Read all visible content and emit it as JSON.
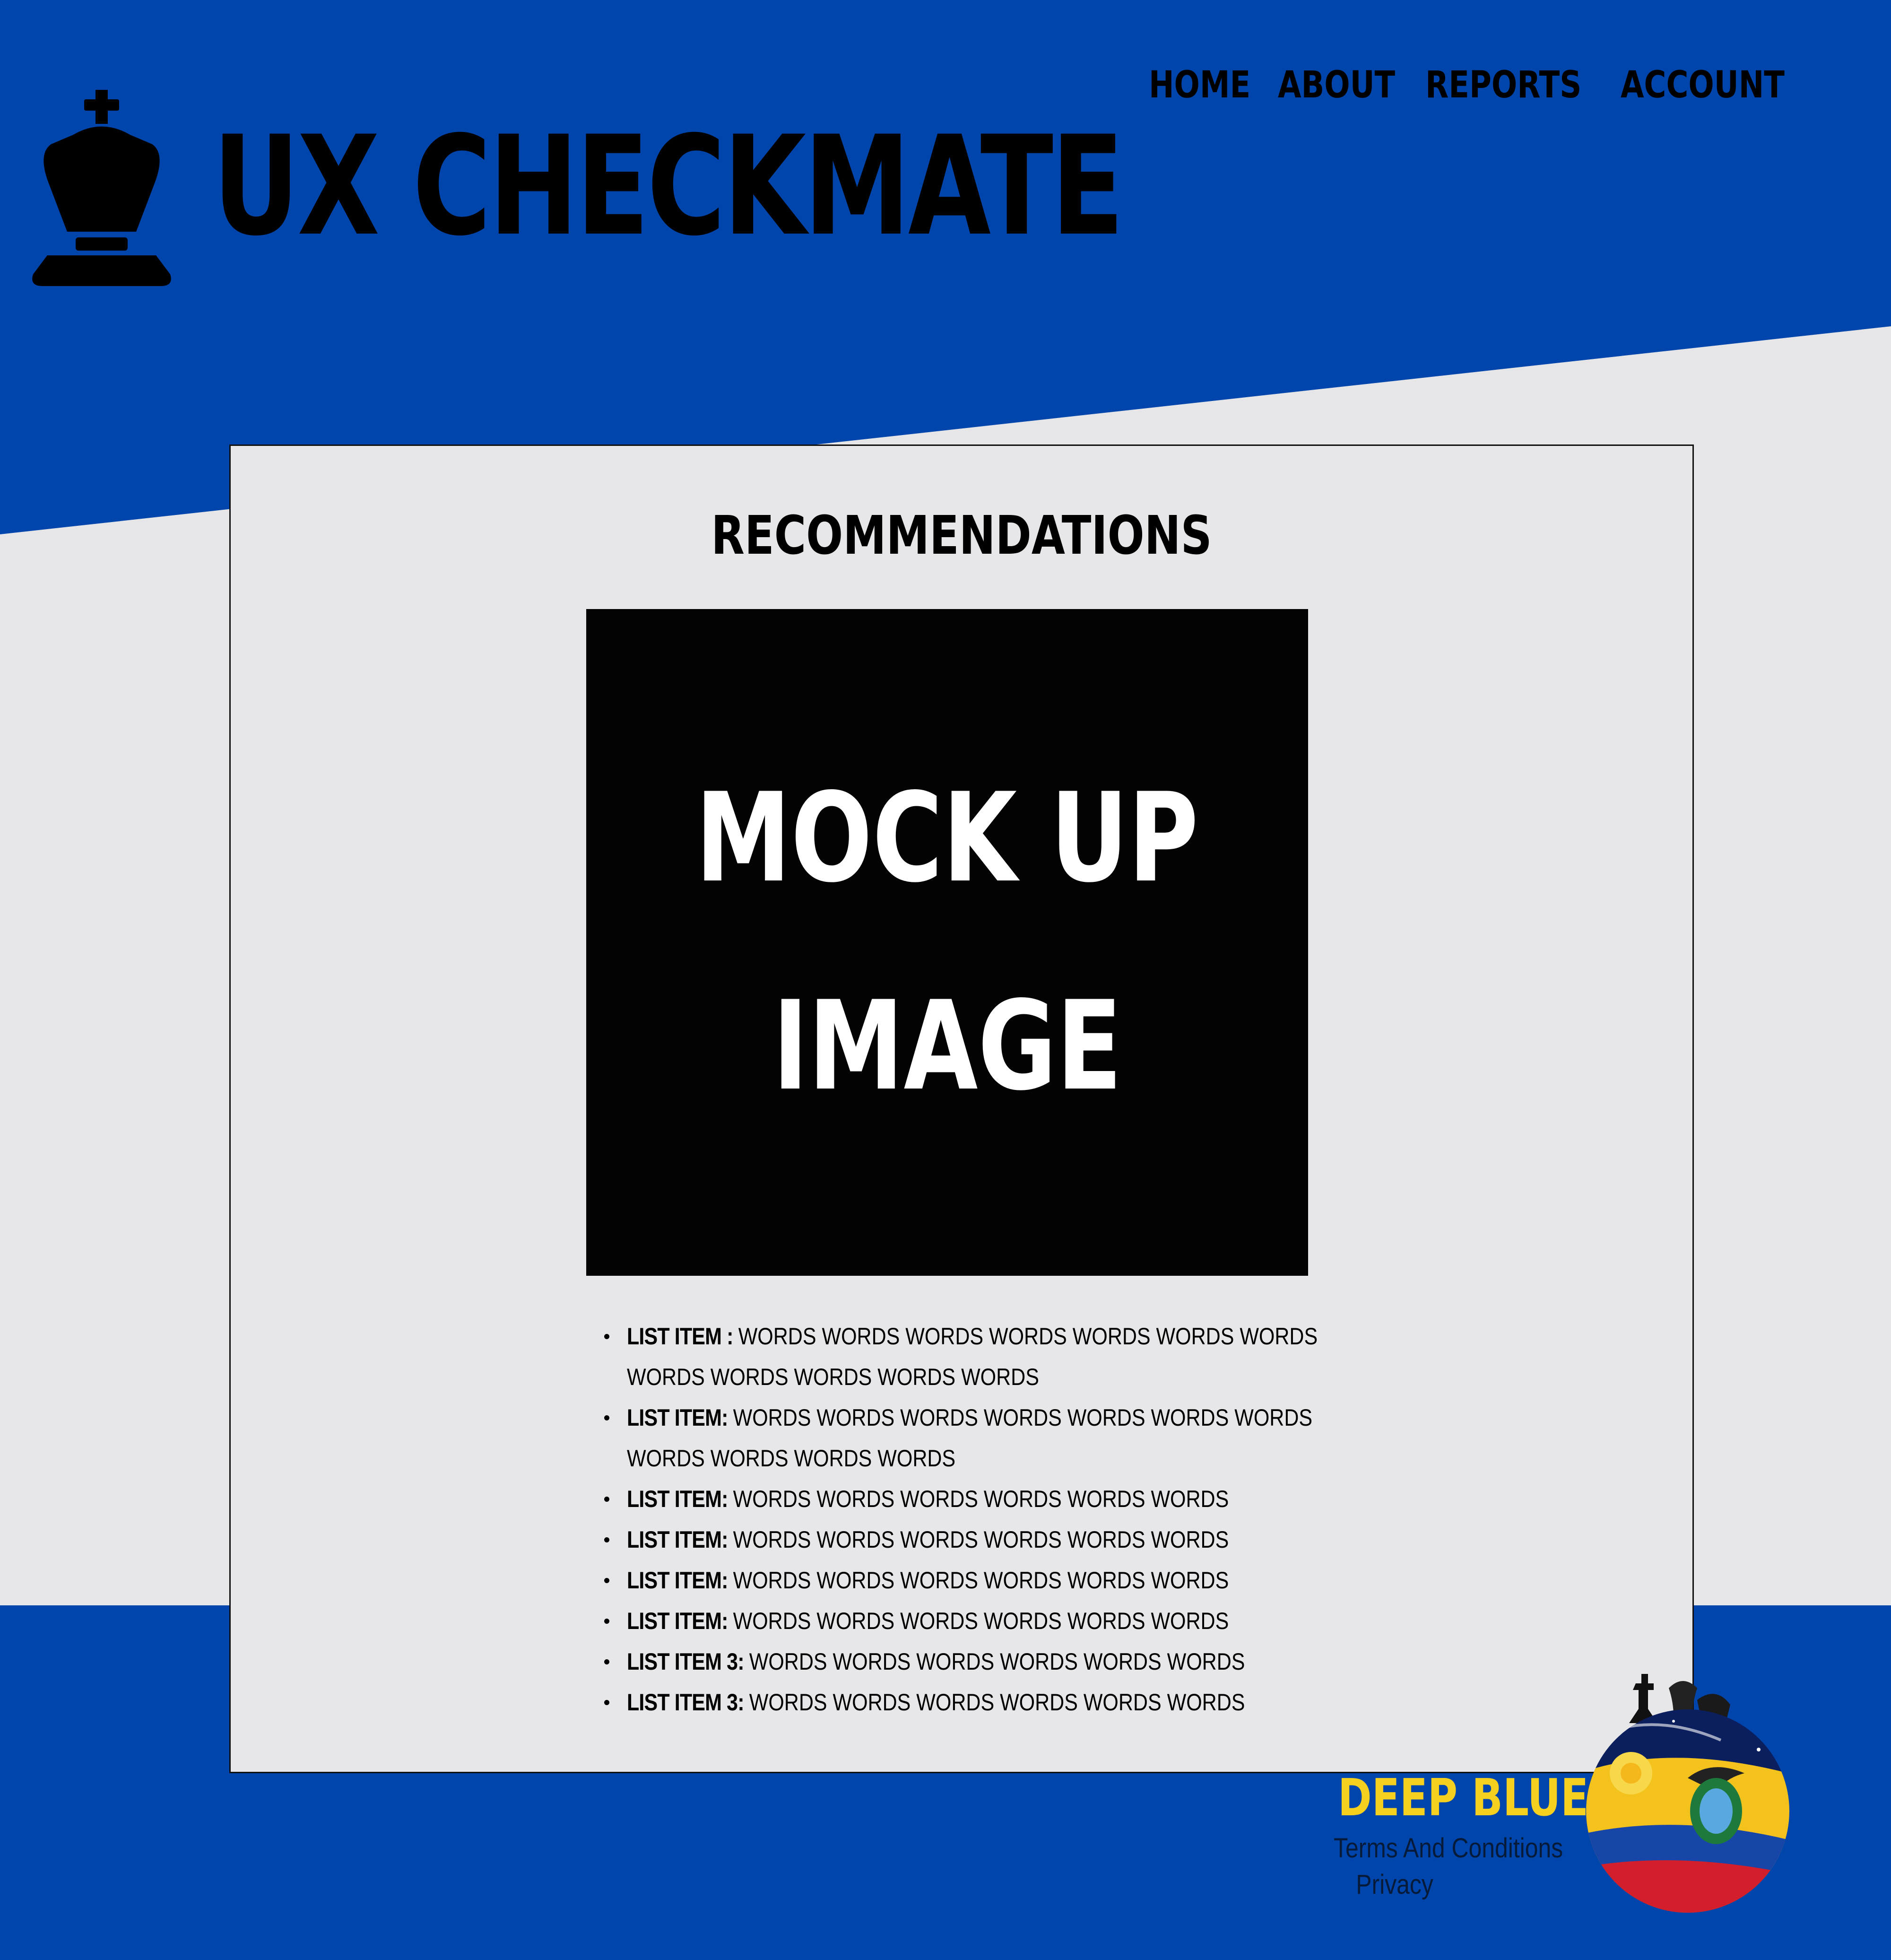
{
  "colors": {
    "brand_blue": "#0045ab",
    "page_bg": "#e6e6e8",
    "card_bg": "#e7e7e9",
    "mockup_bg": "#040304",
    "brand_yellow": "#f5d01f"
  },
  "header": {
    "logo_icon": "chess-king-icon",
    "title": "UX CHECKMATE"
  },
  "nav": {
    "items": [
      {
        "label": "HOME"
      },
      {
        "label": "ABOUT"
      },
      {
        "label": "REPORTS"
      },
      {
        "label": "ACCOUNT"
      }
    ]
  },
  "card": {
    "title": "RECOMMENDATIONS",
    "mockup": {
      "line1": "MOCK UP",
      "line2": "IMAGE"
    },
    "list": [
      {
        "label": "LIST ITEM : ",
        "text": "WORDS WORDS WORDS WORDS WORDS WORDS WORDS WORDS WORDS WORDS WORDS WORDS"
      },
      {
        "label": "LIST ITEM: ",
        "text": "WORDS WORDS WORDS WORDS WORDS WORDS WORDS WORDS WORDS WORDS WORDS"
      },
      {
        "label": "LIST ITEM: ",
        "text": "WORDS WORDS WORDS WORDS WORDS WORDS"
      },
      {
        "label": "LIST ITEM: ",
        "text": "WORDS WORDS WORDS WORDS WORDS WORDS"
      },
      {
        "label": "LIST ITEM: ",
        "text": "WORDS WORDS WORDS WORDS WORDS WORDS"
      },
      {
        "label": "LIST ITEM: ",
        "text": "WORDS WORDS WORDS WORDS WORDS WORDS"
      },
      {
        "label": "LIST ITEM 3: ",
        "text": "WORDS WORDS WORDS WORDS WORDS WORDS"
      },
      {
        "label": "LIST ITEM 3: ",
        "text": "WORDS WORDS WORDS WORDS WORDS WORDS"
      }
    ]
  },
  "footer": {
    "brand": "DEEP BLUE",
    "links": [
      {
        "label": "Terms And Conditions"
      },
      {
        "label": "Privacy"
      }
    ],
    "logo_icon": "deep-blue-emblem-icon"
  }
}
